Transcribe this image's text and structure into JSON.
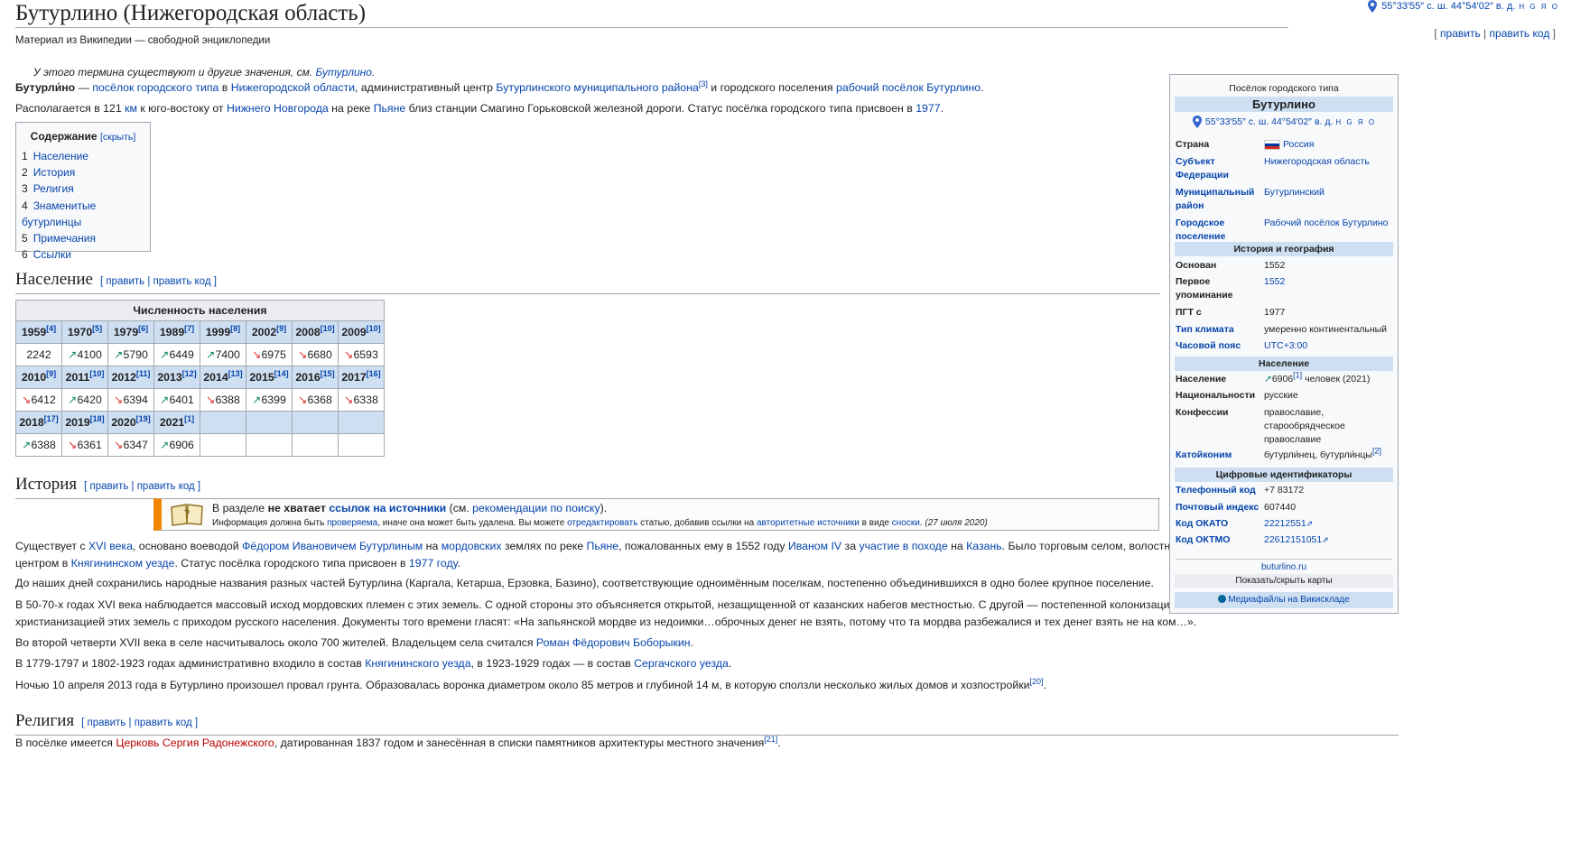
{
  "title": "Бутурлино (Нижегородская область)",
  "top_coords": "55°33′55″ с. ш. 44°54′02″ в. д.",
  "top_coords_geo": "H G Я O",
  "edit_links": {
    "edit": "править",
    "edit_code": "править код",
    "sep": "|"
  },
  "site_sub": "Материал из Википедии — свободной энциклопедии",
  "hatnote": {
    "text": "У этого термина существуют и другие значения, см.",
    "link": "Бутурлино"
  },
  "lead": {
    "p1": {
      "bold": "Бутурли́но",
      "t1": " — ",
      "l1": "посёлок городского типа",
      "t2": " в ",
      "l2": "Нижегородской области",
      "t3": ", административный центр ",
      "l3": "Бутурлинского муниципального района",
      "ref1": "[3]",
      "t4": " и городского поселения ",
      "l4": "рабочий посёлок Бутурлино",
      "t5": "."
    },
    "p2": {
      "t1": "Располагается в 121 ",
      "l1": "км",
      "t2": " к юго-востоку от ",
      "l2": "Нижнего Новгорода",
      "t3": " на реке ",
      "l3": "Пьяне",
      "t4": " близ станции Смагино Горьковской железной дороги. Статус посёлка городского типа присвоен в ",
      "l4": "1977",
      "t5": "."
    }
  },
  "toc": {
    "title": "Содержание",
    "toggle": "[скрыть]",
    "items": [
      {
        "num": "1",
        "label": "Население"
      },
      {
        "num": "2",
        "label": "История"
      },
      {
        "num": "3",
        "label": "Религия"
      },
      {
        "num": "4",
        "label": "Знаменитые бутурлинцы"
      },
      {
        "num": "5",
        "label": "Примечания"
      },
      {
        "num": "6",
        "label": "Ссылки"
      }
    ]
  },
  "sections": {
    "population": {
      "title": "Население",
      "edit": "[ править | править код ]"
    },
    "history": {
      "title": "История",
      "edit": "[ править | править код ]"
    },
    "religion": {
      "title": "Религия",
      "edit": "[ править | править код ]"
    }
  },
  "pop_table": {
    "caption": "Численность населения",
    "rows": [
      {
        "years": [
          [
            "1959",
            "[4]"
          ],
          [
            "1970",
            "[5]"
          ],
          [
            "1979",
            "[6]"
          ],
          [
            "1989",
            "[7]"
          ],
          [
            "1999",
            "[8]"
          ],
          [
            "2002",
            "[9]"
          ],
          [
            "2008",
            "[10]"
          ],
          [
            "2009",
            "[10]"
          ]
        ],
        "values": [
          [
            "",
            "2242"
          ],
          [
            "up",
            "4100"
          ],
          [
            "up",
            "5790"
          ],
          [
            "up",
            "6449"
          ],
          [
            "up",
            "7400"
          ],
          [
            "dn",
            "6975"
          ],
          [
            "dn",
            "6680"
          ],
          [
            "dn",
            "6593"
          ]
        ]
      },
      {
        "years": [
          [
            "2010",
            "[9]"
          ],
          [
            "2011",
            "[10]"
          ],
          [
            "2012",
            "[11]"
          ],
          [
            "2013",
            "[12]"
          ],
          [
            "2014",
            "[13]"
          ],
          [
            "2015",
            "[14]"
          ],
          [
            "2016",
            "[15]"
          ],
          [
            "2017",
            "[16]"
          ]
        ],
        "values": [
          [
            "dn",
            "6412"
          ],
          [
            "up",
            "6420"
          ],
          [
            "dn",
            "6394"
          ],
          [
            "up",
            "6401"
          ],
          [
            "dn",
            "6388"
          ],
          [
            "up",
            "6399"
          ],
          [
            "dn",
            "6368"
          ],
          [
            "dn",
            "6338"
          ]
        ]
      },
      {
        "years": [
          [
            "2018",
            "[17]"
          ],
          [
            "2019",
            "[18]"
          ],
          [
            "2020",
            "[19]"
          ],
          [
            "2021",
            "[1]"
          ],
          [
            "",
            ""
          ],
          [
            "",
            ""
          ],
          [
            "",
            ""
          ],
          [
            "",
            ""
          ]
        ],
        "values": [
          [
            "up",
            "6388"
          ],
          [
            "dn",
            "6361"
          ],
          [
            "dn",
            "6347"
          ],
          [
            "up",
            "6906"
          ],
          [
            "",
            ""
          ],
          [
            "",
            ""
          ],
          [
            "",
            ""
          ],
          [
            "",
            ""
          ]
        ]
      }
    ]
  },
  "ambox": {
    "t1": "В разделе ",
    "b1": "не хватает ",
    "l1": "ссылок на источники",
    "t2": " (см. ",
    "l2": "рекомендации по поиску",
    "t3": ").",
    "s1": "Информация должна быть ",
    "sl1": "проверяема",
    "s2": ", иначе она может быть удалена. Вы можете ",
    "sl2": "отредактировать",
    "s3": " статью, добавив ссылки на ",
    "sl3": "авторитетные источники",
    "s4": " в виде ",
    "sl4": "сноски",
    "s5": ". ",
    "date": "(27 июля 2020)"
  },
  "history": {
    "p1": {
      "t1": "Существует с ",
      "l1": "XVI века",
      "t2": ", основано воеводой ",
      "l2": "Фёдором Ивановичем Бутурлиным",
      "t3": " на ",
      "l3": "мордовских",
      "t4": " землях по реке ",
      "l4": "Пьяне",
      "t5": ", пожалованных ему в 1552 году ",
      "l5": "Иваном IV",
      "t6": " за ",
      "l6": "участие в походе",
      "t7": " на ",
      "l7": "Казань",
      "t8": ". Было торговым селом, волостным",
      "t9": "центром в ",
      "l9": "Княгининском уезде",
      "t10": ". Статус посёлка городского типа присвоен в ",
      "l10": "1977 году",
      "t11": "."
    },
    "p2": "До наших дней сохранились народные названия разных частей Бутурлина (Каргала, Кетарша, Ерзовка, Базино), соответствующие одноимённым поселкам, постепенно объединившихся в одно более крупное поселение.",
    "p3a": "В 50-70-х годах XVI века наблюдается массовый исход мордовских племен с этих земель. С одной стороны это объясняется открытой, незащищенной от казанских набегов местностью. С другой — постепенной колонизацией и",
    "p3b": "христианизацией этих земель с приходом русского населения. Документы того времени гласят: «На запьянской мордве из недоимки…оброчных денег не взять, потому что та мордва разбежалися и тех денег взять не на ком…».",
    "p4": {
      "t1": "Во второй четверти XVII века в селе насчитывалось около 700 жителей. Владельцем села считался ",
      "l1": "Роман Фёдорович Боборыкин",
      "t2": "."
    },
    "p5": {
      "t1": "В 1779-1797 и 1802-1923 годах административно входило в состав ",
      "l1": "Княгининского уезда",
      "t2": ", в 1923-1929 годах — в состав ",
      "l2": "Сергачского уезда",
      "t3": "."
    },
    "p6": {
      "t1": "Ночью 10 апреля 2013 года в Бутурлино произошел провал грунта. Образовалась воронка диаметром около 85 метров и глубиной 14 м, в которую сползли несколько жилых домов и хозпостройки",
      "ref": "[20]",
      "t2": "."
    }
  },
  "religion": {
    "t1": "В посёлке имеется ",
    "l1": "Церковь Сергия Радонежского",
    "t2": ", датированная 1837 годом и занесённая в списки памятников архитектуры местного значения",
    "ref": "[21]",
    "t3": "."
  },
  "infobox": {
    "above": "Посёлок городского типа",
    "name": "Бутурлино",
    "coords": "55°33′55″ с. ш. 44°54′02″ в. д.",
    "coords_geo": "H G Я O",
    "rows1": [
      {
        "label": "Страна",
        "value": "Россия",
        "label_link": false,
        "value_link": true,
        "flag": true
      },
      {
        "label": "Субъект Федерации",
        "value": "Нижегородская область",
        "label_link": true,
        "value_link": true
      },
      {
        "label": "Муниципальный район",
        "value": "Бутурлинский",
        "label_link": true,
        "value_link": true
      },
      {
        "label": "Городское поселение",
        "value": "Рабочий посёлок Бутурлино",
        "label_link": true,
        "value_link": true
      }
    ],
    "head_history": "История и география",
    "rows2": [
      {
        "label": "Основан",
        "value": "1552",
        "label_link": false,
        "value_link": false
      },
      {
        "label": "Первое упоминание",
        "value": "1552",
        "label_link": false,
        "value_link": true
      },
      {
        "label": "ПГТ с",
        "value": "1977",
        "label_link": false,
        "value_link": false
      },
      {
        "label": "Тип климата",
        "value": "умеренно континентальный",
        "label_link": true,
        "value_link": false
      },
      {
        "label": "Часовой пояс",
        "value": "UTC+3:00",
        "label_link": true,
        "value_link": true
      }
    ],
    "head_population": "Население",
    "rows3": [
      {
        "label": "Население",
        "value": "6906",
        "ref": "[1]",
        "value_tail": " человек (2021)",
        "label_link": false,
        "value_link": false,
        "up": true
      },
      {
        "label": "Национальности",
        "value": "русские",
        "label_link": false,
        "value_link": false
      },
      {
        "label": "Конфессии",
        "value": "православие, старообрядческое православие",
        "label_link": false,
        "value_link": false
      },
      {
        "label": "Катойконим",
        "value": "бутурли́нец, бутурли́нцы",
        "ref": "[2]",
        "label_link": true,
        "value_link": false
      }
    ],
    "head_ids": "Цифровые идентификаторы",
    "rows4": [
      {
        "label": "Телефонный код",
        "value": "+7 83172",
        "label_link": true,
        "value_link": false
      },
      {
        "label": "Почтовый индекс",
        "value": "607440",
        "label_link": true,
        "value_link": false
      },
      {
        "label": "Код ОКАТО",
        "value": "22212551",
        "label_link": true,
        "value_link": true,
        "ext": true
      },
      {
        "label": "Код ОКТМО",
        "value": "22612151051",
        "label_link": true,
        "value_link": true,
        "ext": true
      }
    ],
    "site": "buturlino.ru",
    "toggle_maps": "Показать/скрыть карты",
    "commons": "Медиафайлы на Викискладе"
  }
}
